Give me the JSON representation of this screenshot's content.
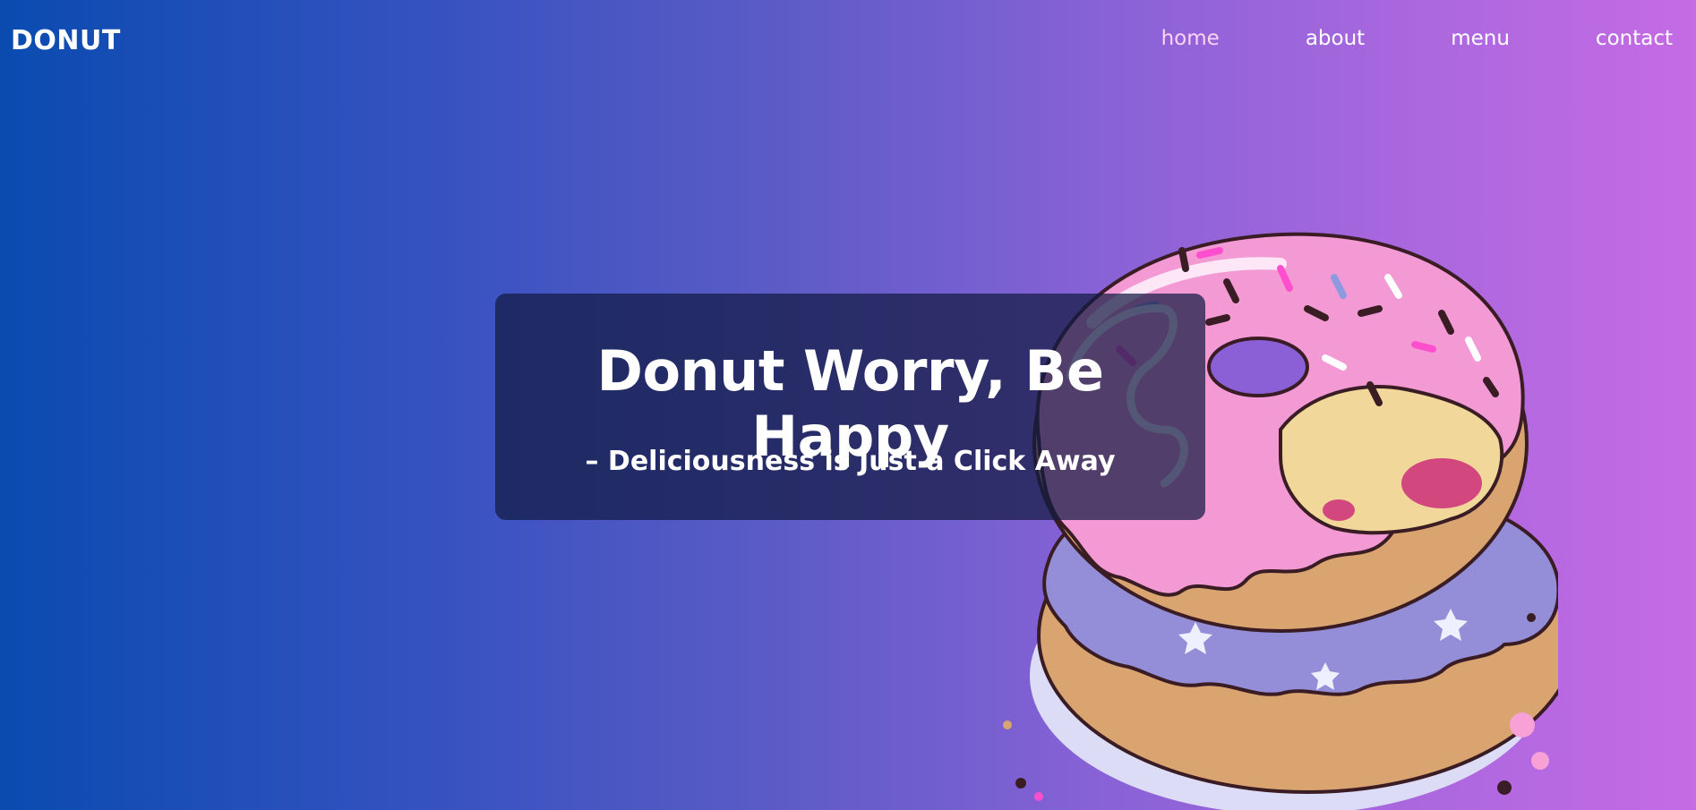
{
  "navbar": {
    "logo": "DONUT",
    "links": [
      {
        "label": "home",
        "active": true
      },
      {
        "label": "about",
        "active": false
      },
      {
        "label": "menu",
        "active": false
      },
      {
        "label": "contact",
        "active": false
      }
    ]
  },
  "hero": {
    "title": "Donut Worry, Be Happy",
    "subtitle": "– Deliciousness is Just a Click Away"
  },
  "colors": {
    "gradient_start": "#0a4bb0",
    "gradient_end": "#c56be4",
    "active_link": "#ffd1f5",
    "box_bg": "#121a42"
  },
  "illustration": {
    "icon": "donut-stack-illustration"
  }
}
